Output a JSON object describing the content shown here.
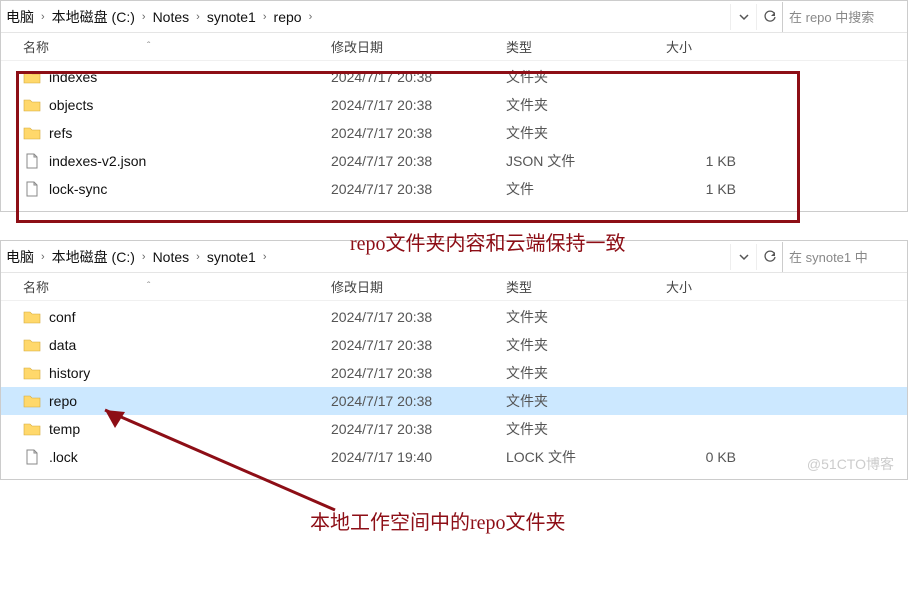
{
  "top": {
    "breadcrumb": [
      "电脑",
      "本地磁盘 (C:)",
      "Notes",
      "synote1",
      "repo"
    ],
    "search_placeholder": "在 repo 中搜索",
    "headers": {
      "name": "名称",
      "date": "修改日期",
      "type": "类型",
      "size": "大小"
    },
    "rows": [
      {
        "icon": "folder",
        "name": "indexes",
        "date": "2024/7/17 20:38",
        "type": "文件夹",
        "size": ""
      },
      {
        "icon": "folder",
        "name": "objects",
        "date": "2024/7/17 20:38",
        "type": "文件夹",
        "size": ""
      },
      {
        "icon": "folder",
        "name": "refs",
        "date": "2024/7/17 20:38",
        "type": "文件夹",
        "size": ""
      },
      {
        "icon": "file",
        "name": "indexes-v2.json",
        "date": "2024/7/17 20:38",
        "type": "JSON 文件",
        "size": "1 KB"
      },
      {
        "icon": "file",
        "name": "lock-sync",
        "date": "2024/7/17 20:38",
        "type": "文件",
        "size": "1 KB"
      }
    ]
  },
  "bottom": {
    "breadcrumb": [
      "电脑",
      "本地磁盘 (C:)",
      "Notes",
      "synote1"
    ],
    "search_placeholder": "在 synote1 中",
    "headers": {
      "name": "名称",
      "date": "修改日期",
      "type": "类型",
      "size": "大小"
    },
    "rows": [
      {
        "icon": "folder",
        "name": "conf",
        "date": "2024/7/17 20:38",
        "type": "文件夹",
        "size": "",
        "sel": false
      },
      {
        "icon": "folder",
        "name": "data",
        "date": "2024/7/17 20:38",
        "type": "文件夹",
        "size": "",
        "sel": false
      },
      {
        "icon": "folder",
        "name": "history",
        "date": "2024/7/17 20:38",
        "type": "文件夹",
        "size": "",
        "sel": false
      },
      {
        "icon": "folder",
        "name": "repo",
        "date": "2024/7/17 20:38",
        "type": "文件夹",
        "size": "",
        "sel": true
      },
      {
        "icon": "folder",
        "name": "temp",
        "date": "2024/7/17 20:38",
        "type": "文件夹",
        "size": "",
        "sel": false
      },
      {
        "icon": "file",
        "name": ".lock",
        "date": "2024/7/17 19:40",
        "type": "LOCK 文件",
        "size": "0 KB",
        "sel": false
      }
    ]
  },
  "annotations": {
    "top_note": "repo文件夹内容和云端保持一致",
    "bottom_note": "本地工作空间中的repo文件夹"
  },
  "watermark": "@51CTO博客"
}
